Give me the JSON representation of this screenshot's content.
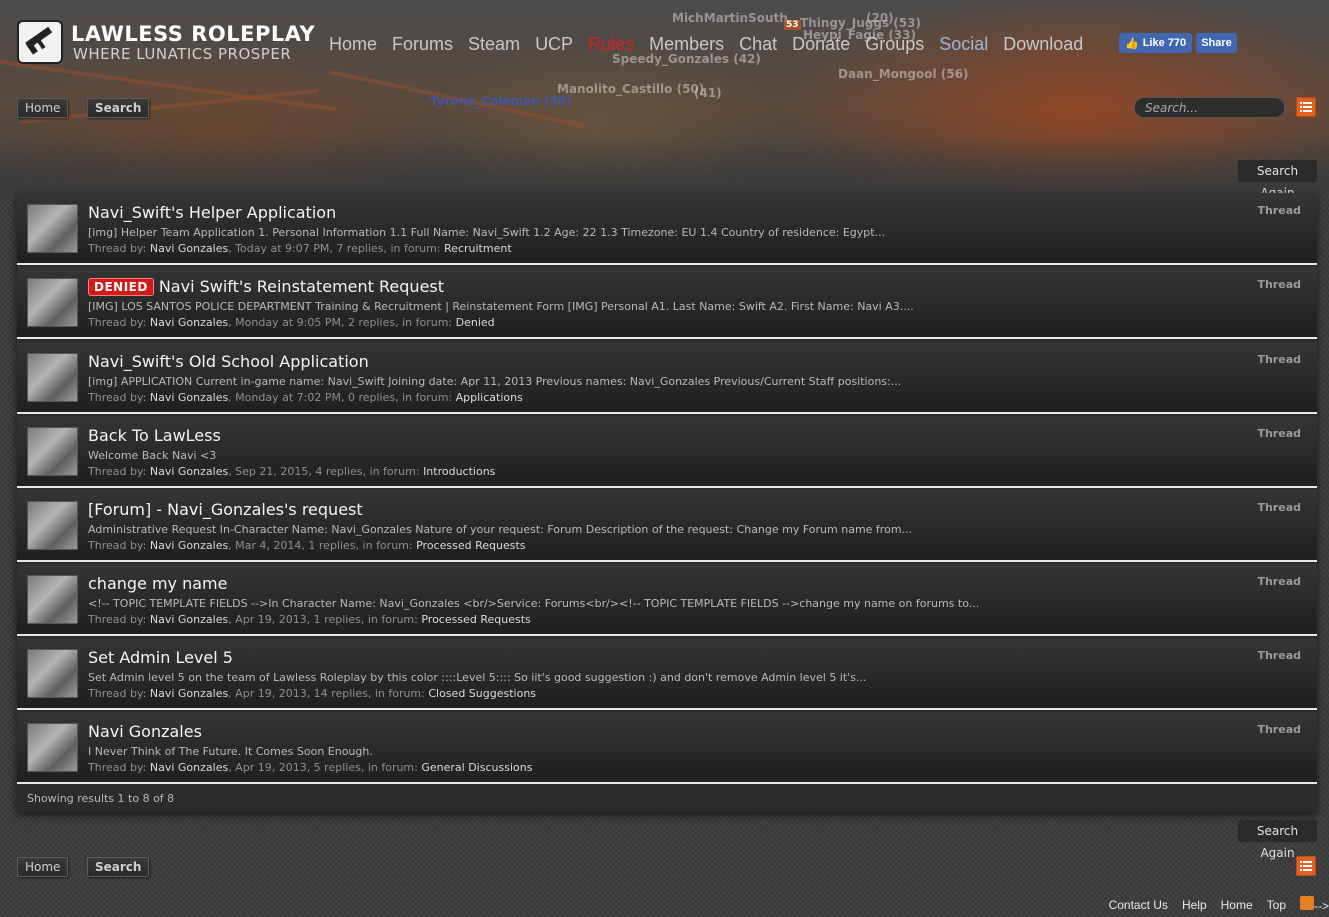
{
  "brand": {
    "title": "LAWLESS ROLEPLAY",
    "tagline": "WHERE LUNATICS PROSPER"
  },
  "nav": [
    "Home",
    "Forums",
    "Steam",
    "UCP",
    "Rules",
    "Members",
    "Chat",
    "Donate",
    "Groups",
    "Social",
    "Download"
  ],
  "facebook": {
    "like_label": "Like 770",
    "share_label": "Share"
  },
  "scene_tags": [
    "MichMartinSouth",
    "(20)",
    "Thingy_Juggs (53)",
    "Heypi_Fagie (33)",
    "Speedy_Gonzales (42)",
    "Daan_Mongool (56)",
    "Manolito_Castillo (50)",
    "(41)",
    "Tyrone_Coleman (50)",
    "53"
  ],
  "breadcrumb": {
    "home": "Home",
    "search": "Search"
  },
  "search": {
    "placeholder": "Search..."
  },
  "search_again_label": "Search Again",
  "thread_by_label": "Thread by:",
  "results": [
    {
      "title": "Navi_Swift's Helper Application",
      "badge": "",
      "snippet": "[img] Helper Team Application 1. Personal Information 1.1 Full Name: Navi_Swift 1.2 Age: 22 1.3 Timezone: EU 1.4 Country of residence: Egypt...",
      "user": "Navi Gonzales",
      "details": ", Today at 9:07 PM, 7 replies, in forum: ",
      "forum": "Recruitment",
      "type": "Thread"
    },
    {
      "title": "Navi Swift's Reinstatement Request",
      "badge": "DENIED",
      "snippet": "[IMG] LOS SANTOS POLICE DEPARTMENT Training & Recruitment | Reinstatement Form [IMG] Personal A1. Last Name: Swift A2. First Name: Navi A3....",
      "user": "Navi Gonzales",
      "details": ", Monday at 9:05 PM, 2 replies, in forum: ",
      "forum": "Denied",
      "type": "Thread"
    },
    {
      "title": "Navi_Swift's Old School Application",
      "badge": "",
      "snippet": "[img] APPLICATION Current in-game name: Navi_Swift Joining date: Apr 11, 2013 Previous names: Navi_Gonzales Previous/Current Staff positions:...",
      "user": "Navi Gonzales",
      "details": ", Monday at 7:02 PM, 0 replies, in forum: ",
      "forum": "Applications",
      "type": "Thread"
    },
    {
      "title": "Back To LawLess",
      "badge": "",
      "snippet": "Welcome Back Navi <3",
      "user": "Navi Gonzales",
      "details": ", Sep 21, 2015, 4 replies, in forum: ",
      "forum": "Introductions",
      "type": "Thread"
    },
    {
      "title": "[Forum] - Navi_Gonzales's request",
      "badge": "",
      "snippet": "Administrative Request In-Character Name: Navi_Gonzales Nature of your request: Forum Description of the request: Change my Forum name from...",
      "user": "Navi Gonzales",
      "details": ", Mar 4, 2014, 1 replies, in forum: ",
      "forum": "Processed Requests",
      "type": "Thread"
    },
    {
      "title": "change my name",
      "badge": "",
      "snippet": "<!-- TOPIC TEMPLATE FIELDS -->In Character Name: Navi_Gonzales <br/>Service: Forums<br/><!-- TOPIC TEMPLATE FIELDS -->change my name on forums to...",
      "user": "Navi Gonzales",
      "details": ", Apr 19, 2013, 1 replies, in forum: ",
      "forum": "Processed Requests",
      "type": "Thread"
    },
    {
      "title": "Set Admin Level 5",
      "badge": "",
      "snippet": "Set Admin level 5 on the team of Lawless Roleplay by this color ::::Level 5:::: So iit's good suggestion :) and don't remove Admin level 5 it's...",
      "user": "Navi Gonzales",
      "details": ", Apr 19, 2013, 14 replies, in forum: ",
      "forum": "Closed Suggestions",
      "type": "Thread"
    },
    {
      "title": "Navi Gonzales",
      "badge": "",
      "snippet": "I Never Think of The Future. It Comes Soon Enough.",
      "user": "Navi Gonzales",
      "details": ", Apr 19, 2013, 5 replies, in forum: ",
      "forum": "General Discussions",
      "type": "Thread"
    }
  ],
  "results_footer": "Showing results 1 to 8 of 8",
  "footer": {
    "contact": "Contact Us",
    "help": "Help",
    "home": "Home",
    "top": "Top",
    "rss_suffix": "-->"
  },
  "colors": {
    "rules_red": "#d42121",
    "denied_red": "#d11a1a",
    "social_blue": "#9db7d8",
    "menu_orange": "#e0621f",
    "facebook_blue": "#4267b2"
  },
  "icons": {
    "logo": "gun-logo-icon",
    "menu": "list-menu-icon",
    "rss": "rss-icon",
    "facebook": "thumbs-up-icon"
  }
}
